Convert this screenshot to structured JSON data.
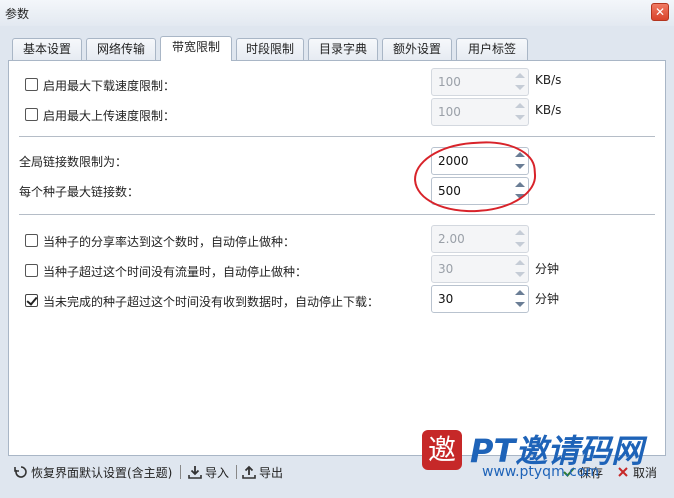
{
  "window": {
    "title": "参数",
    "close_label": "✕"
  },
  "tabs": [
    {
      "label": "基本设置",
      "active": false
    },
    {
      "label": "网络传输",
      "active": false
    },
    {
      "label": "带宽限制",
      "active": true
    },
    {
      "label": "时段限制",
      "active": false
    },
    {
      "label": "目录字典",
      "active": false
    },
    {
      "label": "额外设置",
      "active": false
    },
    {
      "label": "用户标签",
      "active": false
    }
  ],
  "speed_limits": {
    "download": {
      "label": "启用最大下载速度限制：",
      "checked": false,
      "value": "100",
      "unit": "KB/s"
    },
    "upload": {
      "label": "启用最大上传速度限制：",
      "checked": false,
      "value": "100",
      "unit": "KB/s"
    }
  },
  "connections": {
    "global": {
      "label": "全局链接数限制为：",
      "value": "2000"
    },
    "per_torrent": {
      "label": "每个种子最大链接数：",
      "value": "500"
    }
  },
  "auto_stop": {
    "share_ratio": {
      "label": "当种子的分享率达到这个数时，自动停止做种：",
      "checked": false,
      "value": "2.00",
      "unit": ""
    },
    "no_traffic": {
      "label": "当种子超过这个时间没有流量时，自动停止做种：",
      "checked": false,
      "value": "30",
      "unit": "分钟"
    },
    "no_data": {
      "label": "当未完成的种子超过这个时间没有收到数据时，自动停止下载：",
      "checked": true,
      "value": "30",
      "unit": "分钟"
    }
  },
  "footer": {
    "reset_label": "恢复界面默认设置(含主题)",
    "import_label": "导入",
    "export_label": "导出",
    "save_label": "保存",
    "cancel_label": "取消"
  },
  "watermark": {
    "logo_char": "邀",
    "text": "PT邀请码网",
    "url": "www.ptyqm.com"
  },
  "colors": {
    "annotation": "#d8232a",
    "watermark": "#1e63b8"
  }
}
